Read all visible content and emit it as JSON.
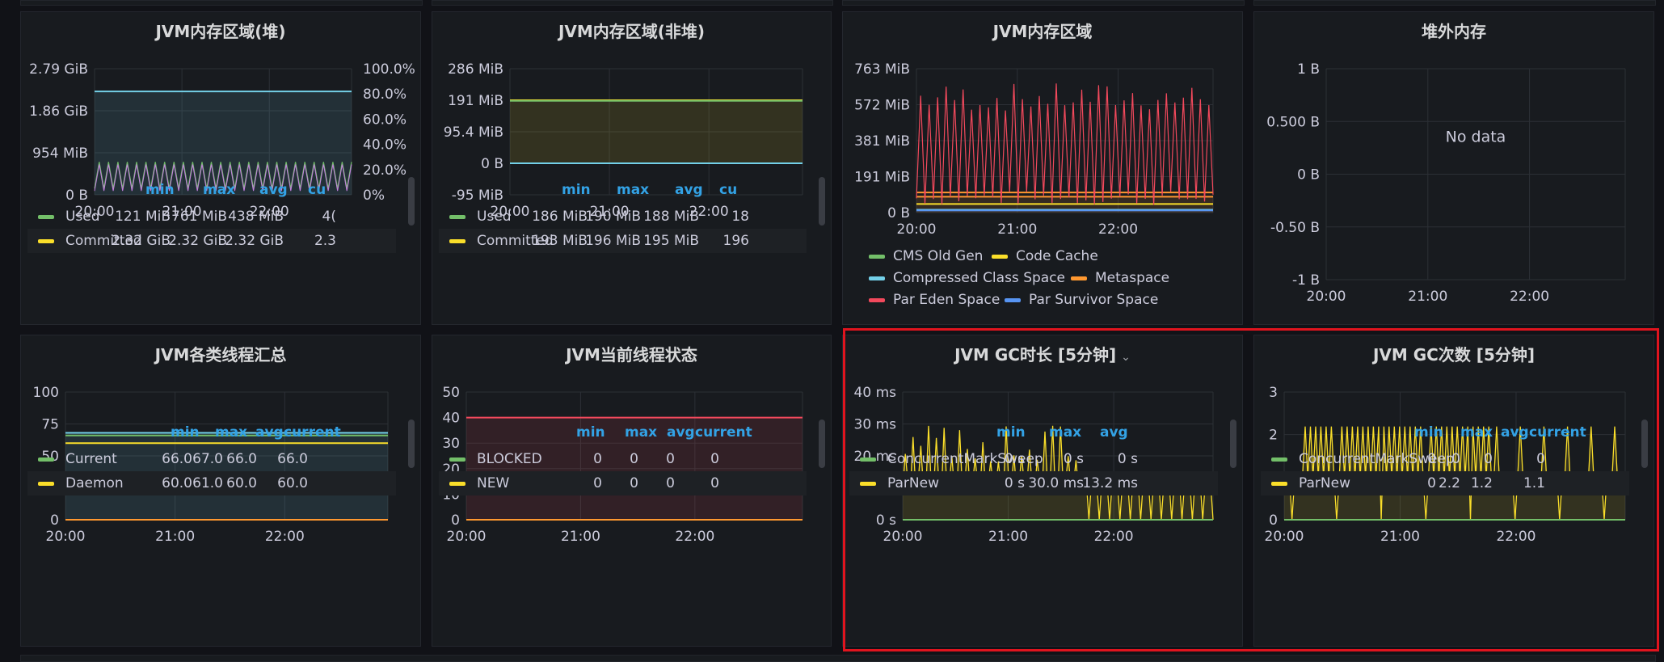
{
  "colors": {
    "green": "#73bf69",
    "yellow": "#fade2a",
    "blue": "#5794f2",
    "cyan": "#73d0e8",
    "orange": "#ff9830",
    "red": "#f2495c",
    "accent": "#33a2e5",
    "highlight": "#e0141e"
  },
  "panels": [
    {
      "id": "p1",
      "title": "JVM内存区域(堆)",
      "box": [
        25,
        14,
        496,
        388
      ],
      "plot": [
        116,
        84,
        434,
        240
      ],
      "yticks": [
        "2.79 GiB",
        "1.86 GiB",
        "954 MiB",
        "0 B"
      ],
      "y2ticks": [
        "100.0%",
        "80.0%",
        "60.0%",
        "40.0%",
        "20.0%",
        "0%"
      ],
      "xticks": [
        "20:00",
        "21:00",
        "22:00"
      ],
      "legend_headers": [
        "min",
        "max",
        "avg",
        "cu"
      ],
      "rows": [
        {
          "name": "Used",
          "color": "green",
          "vals": [
            "121 MiB",
            "761 MiB",
            "438 MiB",
            "4("
          ]
        },
        {
          "name": "Committed",
          "color": "yellow",
          "vals": [
            "2.32 GiB",
            "2.32 GiB",
            "2.32 GiB",
            "2.3"
          ]
        }
      ]
    },
    {
      "id": "p2",
      "title": "JVM内存区域(非堆)",
      "box": [
        534,
        14,
        495,
        388
      ],
      "plot": [
        630,
        84,
        992,
        240
      ],
      "yticks": [
        "286 MiB",
        "191 MiB",
        "95.4 MiB",
        "0 B",
        "-95 MiB"
      ],
      "xticks": [
        "20:00",
        "21:00",
        "22:00"
      ],
      "legend_headers": [
        "min",
        "max",
        "avg",
        "cu"
      ],
      "rows": [
        {
          "name": "Used",
          "color": "green",
          "vals": [
            "186 MiB",
            "190 MiB",
            "188 MiB",
            "18"
          ]
        },
        {
          "name": "Committed",
          "color": "yellow",
          "vals": [
            "193 MiB",
            "196 MiB",
            "195 MiB",
            "196"
          ]
        }
      ]
    },
    {
      "id": "p3",
      "title": "JVM内存区域",
      "box": [
        1042,
        14,
        496,
        388
      ],
      "plot": [
        1133,
        84,
        1500,
        262
      ],
      "yticks": [
        "763 MiB",
        "572 MiB",
        "381 MiB",
        "191 MiB",
        "0 B"
      ],
      "xticks": [
        "20:00",
        "21:00",
        "22:00"
      ],
      "legend_items": [
        {
          "name": "CMS Old Gen",
          "color": "green"
        },
        {
          "name": "Code Cache",
          "color": "yellow"
        },
        {
          "name": "Compressed Class Space",
          "color": "cyan"
        },
        {
          "name": "Metaspace",
          "color": "orange"
        },
        {
          "name": "Par Eden Space",
          "color": "red"
        },
        {
          "name": "Par Survivor Space",
          "color": "blue"
        }
      ]
    },
    {
      "id": "p4",
      "title": "堆外内存",
      "box": [
        1551,
        14,
        496,
        388
      ],
      "plot": [
        1640,
        84,
        2010,
        345
      ],
      "yticks": [
        "1 B",
        "0.500 B",
        "0 B",
        "-0.50 B",
        "-1 B"
      ],
      "xticks": [
        "20:00",
        "21:00",
        "22:00"
      ],
      "nodata": "No data"
    },
    {
      "id": "p5",
      "title": "JVM各类线程汇总",
      "box": [
        25,
        414,
        496,
        386
      ],
      "plot": [
        80,
        484,
        479,
        642
      ],
      "yticks": [
        "100",
        "75",
        "50",
        "25",
        "0"
      ],
      "xticks": [
        "20:00",
        "21:00",
        "22:00"
      ],
      "legend_headers": [
        "min",
        "max",
        "avg",
        "current"
      ],
      "rows": [
        {
          "name": "Current",
          "color": "green",
          "vals": [
            "66.0",
            "67.0",
            "66.0",
            "66.0"
          ]
        },
        {
          "name": "Daemon",
          "color": "yellow",
          "vals": [
            "60.0",
            "61.0",
            "60.0",
            "60.0"
          ]
        }
      ]
    },
    {
      "id": "p6",
      "title": "JVM当前线程状态",
      "box": [
        534,
        414,
        495,
        386
      ],
      "plot": [
        576,
        484,
        992,
        642
      ],
      "yticks": [
        "50",
        "40",
        "30",
        "20",
        "10",
        "0"
      ],
      "xticks": [
        "20:00",
        "21:00",
        "22:00"
      ],
      "legend_headers": [
        "min",
        "max",
        "avg",
        "current"
      ],
      "rows": [
        {
          "name": "BLOCKED",
          "color": "green",
          "vals": [
            "0",
            "0",
            "0",
            "0"
          ]
        },
        {
          "name": "NEW",
          "color": "yellow",
          "vals": [
            "0",
            "0",
            "0",
            "0"
          ]
        }
      ]
    },
    {
      "id": "p7",
      "title": "JVM GC时长 [5分钟]",
      "box": [
        1042,
        414,
        496,
        386
      ],
      "caret": true,
      "plot": [
        1116,
        484,
        1500,
        642
      ],
      "yticks": [
        "40 ms",
        "30 ms",
        "20 ms",
        "10 ms",
        "0 s"
      ],
      "xticks": [
        "20:00",
        "21:00",
        "22:00"
      ],
      "legend_headers": [
        "min",
        "max",
        "avg"
      ],
      "rows": [
        {
          "name": "ConcurrentMarkSweep",
          "color": "green",
          "vals": [
            "0 s",
            "0 s",
            "0 s"
          ]
        },
        {
          "name": "ParNew",
          "color": "yellow",
          "vals": [
            "0 s",
            "30.0 ms",
            "13.2 ms"
          ]
        }
      ]
    },
    {
      "id": "p8",
      "title": "JVM GC次数 [5分钟]",
      "box": [
        1551,
        414,
        496,
        386
      ],
      "plot": [
        1588,
        484,
        2010,
        642
      ],
      "yticks": [
        "3",
        "2",
        "1",
        "0"
      ],
      "xticks": [
        "20:00",
        "21:00",
        "22:00"
      ],
      "legend_headers": [
        "min",
        "max",
        "avg",
        "current"
      ],
      "rows": [
        {
          "name": "ConcurrentMarkSweep",
          "color": "green",
          "vals": [
            "0",
            "0",
            "0",
            "0"
          ]
        },
        {
          "name": "ParNew",
          "color": "yellow",
          "vals": [
            "0",
            "2.2",
            "1.2",
            "1.1"
          ]
        }
      ]
    }
  ],
  "chart_data": [
    {
      "type": "line",
      "title": "JVM内存区域(堆)",
      "x": [
        "20:00",
        "21:00",
        "22:00"
      ],
      "series": [
        {
          "name": "Used",
          "min": "121 MiB",
          "max": "761 MiB",
          "avg": "438 MiB"
        },
        {
          "name": "Committed",
          "value": "2.32 GiB"
        }
      ]
    },
    {
      "type": "line",
      "title": "JVM内存区域(非堆)",
      "x": [
        "20:00",
        "21:00",
        "22:00"
      ],
      "series": [
        {
          "name": "Used",
          "min": "186 MiB",
          "max": "190 MiB",
          "avg": "188 MiB"
        },
        {
          "name": "Committed",
          "min": "193 MiB",
          "max": "196 MiB",
          "avg": "195 MiB"
        }
      ]
    },
    {
      "type": "line",
      "title": "JVM内存区域",
      "x": [
        "20:00",
        "21:00",
        "22:00"
      ],
      "series": [
        {
          "name": "CMS Old Gen"
        },
        {
          "name": "Code Cache"
        },
        {
          "name": "Compressed Class Space"
        },
        {
          "name": "Metaspace"
        },
        {
          "name": "Par Eden Space"
        },
        {
          "name": "Par Survivor Space"
        }
      ]
    },
    {
      "type": "line",
      "title": "堆外内存",
      "x": [
        "20:00",
        "21:00",
        "22:00"
      ],
      "series": []
    },
    {
      "type": "line",
      "title": "JVM各类线程汇总",
      "x": [
        "20:00",
        "21:00",
        "22:00"
      ],
      "ylim": [
        0,
        100
      ],
      "series": [
        {
          "name": "Current",
          "min": 66,
          "max": 67,
          "avg": 66,
          "current": 66
        },
        {
          "name": "Daemon",
          "min": 60,
          "max": 61,
          "avg": 60,
          "current": 60
        }
      ]
    },
    {
      "type": "line",
      "title": "JVM当前线程状态",
      "x": [
        "20:00",
        "21:00",
        "22:00"
      ],
      "ylim": [
        0,
        50
      ],
      "series": [
        {
          "name": "BLOCKED",
          "min": 0,
          "max": 0,
          "avg": 0,
          "current": 0
        },
        {
          "name": "NEW",
          "min": 0,
          "max": 0,
          "avg": 0,
          "current": 0
        }
      ]
    },
    {
      "type": "line",
      "title": "JVM GC时长 [5分钟]",
      "x": [
        "20:00",
        "21:00",
        "22:00"
      ],
      "ylim": [
        0,
        40
      ],
      "series": [
        {
          "name": "ConcurrentMarkSweep",
          "min": "0 s",
          "max": "0 s",
          "avg": "0 s"
        },
        {
          "name": "ParNew",
          "min": "0 s",
          "max": "30.0 ms",
          "avg": "13.2 ms"
        }
      ]
    },
    {
      "type": "line",
      "title": "JVM GC次数 [5分钟]",
      "x": [
        "20:00",
        "21:00",
        "22:00"
      ],
      "ylim": [
        0,
        3
      ],
      "series": [
        {
          "name": "ConcurrentMarkSweep",
          "min": 0,
          "max": 0,
          "avg": 0,
          "current": 0
        },
        {
          "name": "ParNew",
          "min": 0,
          "max": 2.2,
          "avg": 1.2,
          "current": 1.1
        }
      ]
    }
  ]
}
